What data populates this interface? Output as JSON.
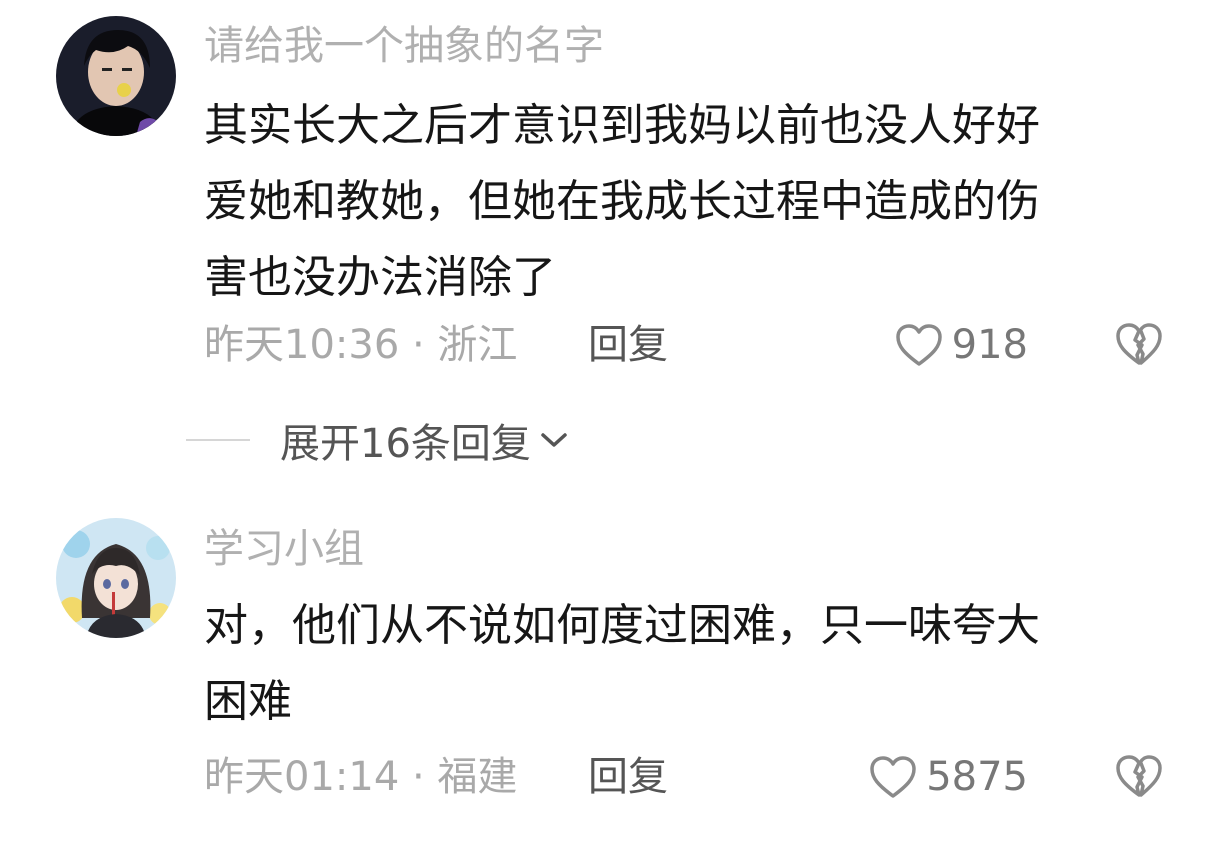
{
  "comments": [
    {
      "username": "请给我一个抽象的名字",
      "lines": [
        "其实长大之后才意识到我妈以前也没人好好",
        "爱她和教她，但她在我成长过程中造成的伤",
        "害也没办法消除了"
      ],
      "time_location": "昨天10:36 · 浙江",
      "reply_label": "回复",
      "likes": "918"
    },
    {
      "username": "学习小组",
      "lines": [
        "对，他们从不说如何度过困难，只一味夸大",
        "困难"
      ],
      "time_location": "昨天01:14 · 福建",
      "reply_label": "回复",
      "likes": "5875"
    }
  ],
  "expand_replies": {
    "label": "展开16条回复",
    "icon": "chevron-down-icon"
  },
  "icons": {
    "like": "heart-outline-icon",
    "dislike": "broken-heart-icon"
  },
  "colors": {
    "username": "#b0b0b0",
    "content": "#161616",
    "meta": "#a9a9a9",
    "action": "#555555"
  }
}
